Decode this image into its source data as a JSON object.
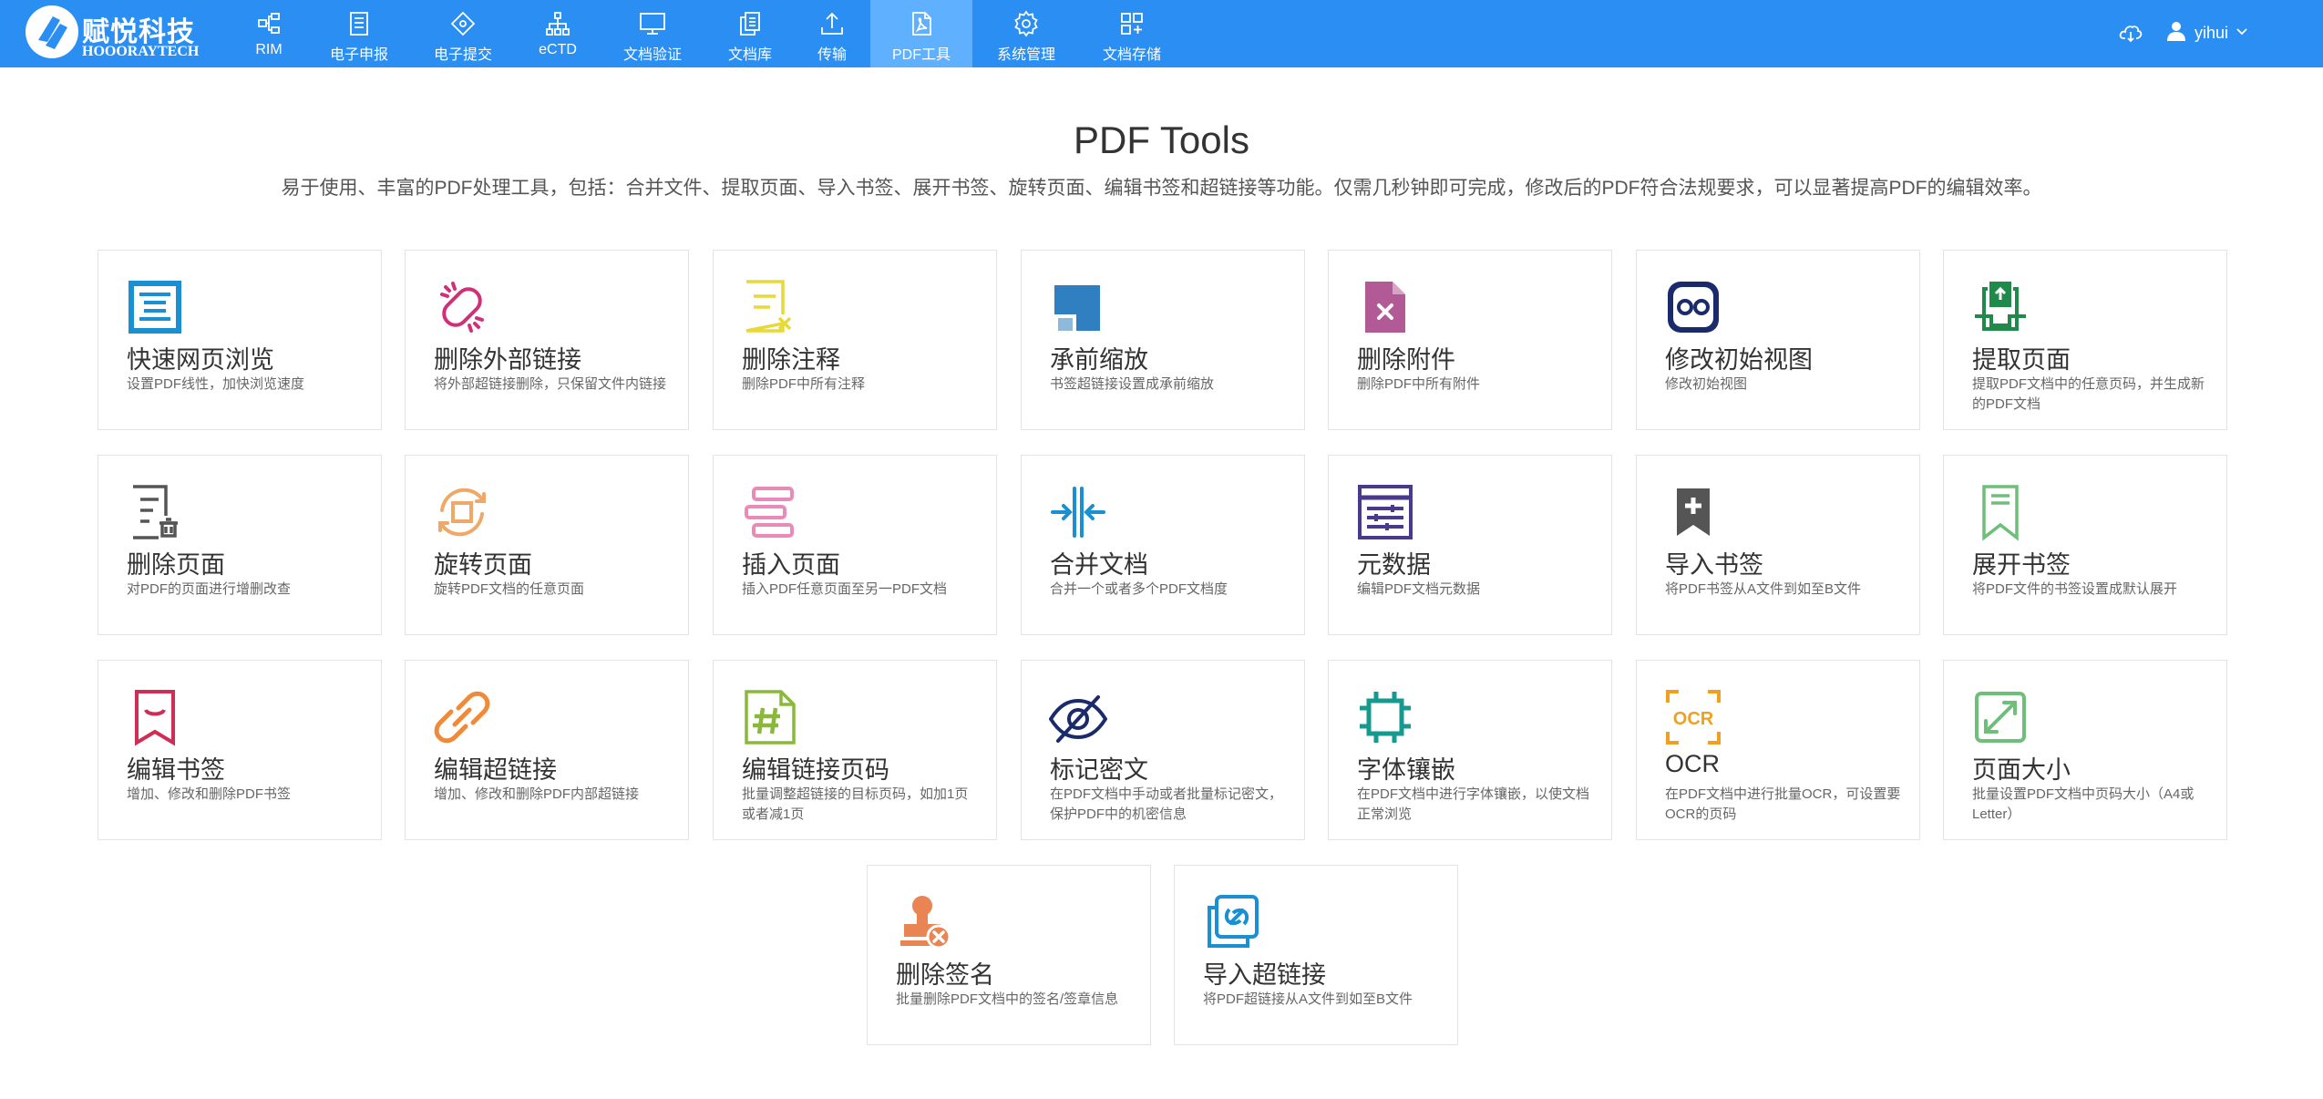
{
  "logo": {
    "cn": "赋悦科技",
    "en": "HOOORAYTECH"
  },
  "nav": [
    {
      "label": "RIM",
      "icon": "hierarchy-icon"
    },
    {
      "label": "电子申报",
      "icon": "document-list-icon"
    },
    {
      "label": "电子提交",
      "icon": "diamond-icon"
    },
    {
      "label": "eCTD",
      "icon": "sitemap-icon"
    },
    {
      "label": "文档验证",
      "icon": "monitor-icon"
    },
    {
      "label": "文档库",
      "icon": "documents-icon"
    },
    {
      "label": "传输",
      "icon": "upload-icon"
    },
    {
      "label": "PDF工具",
      "icon": "pdf-icon",
      "active": true
    },
    {
      "label": "系统管理",
      "icon": "gear-icon"
    },
    {
      "label": "文档存储",
      "icon": "grid-plus-icon"
    }
  ],
  "user": {
    "name": "yihui"
  },
  "header": {
    "title": "PDF Tools",
    "description": "易于使用、丰富的PDF处理工具，包括：合并文件、提取页面、导入书签、展开书签、旋转页面、编辑书签和超链接等功能。仅需几秒钟即可完成，修改后的PDF符合法规要求，可以显著提高PDF的编辑效率。"
  },
  "tools": [
    {
      "title": "快速网页浏览",
      "desc": "设置PDF线性，加快浏览速度",
      "icon": "fast-web-view-icon",
      "color": "#1a8fd1"
    },
    {
      "title": "删除外部链接",
      "desc": "将外部超链接删除，只保留文件内链接",
      "icon": "broken-link-icon",
      "color": "#d0307a"
    },
    {
      "title": "删除注释",
      "desc": "删除PDF中所有注释",
      "icon": "delete-note-icon",
      "color": "#e8d93a"
    },
    {
      "title": "承前缩放",
      "desc": "书签超链接设置成承前缩放",
      "icon": "inherit-zoom-icon",
      "color": "#2f7fc1"
    },
    {
      "title": "删除附件",
      "desc": "删除PDF中所有附件",
      "icon": "delete-attachment-icon",
      "color": "#b25a96"
    },
    {
      "title": "修改初始视图",
      "desc": "修改初始视图",
      "icon": "initial-view-icon",
      "color": "#1b2a6b"
    },
    {
      "title": "提取页面",
      "desc": "提取PDF文档中的任意页码，并生成新的PDF文档",
      "icon": "extract-page-icon",
      "color": "#1f8a4a"
    },
    {
      "title": "删除页面",
      "desc": "对PDF的页面进行增删改查",
      "icon": "delete-page-icon",
      "color": "#555555"
    },
    {
      "title": "旋转页面",
      "desc": "旋转PDF文档的任意页面",
      "icon": "rotate-page-icon",
      "color": "#f0a868"
    },
    {
      "title": "插入页面",
      "desc": "插入PDF任意页面至另一PDF文档",
      "icon": "insert-page-icon",
      "color": "#e88bb8"
    },
    {
      "title": "合并文档",
      "desc": "合并一个或者多个PDF文档度",
      "icon": "merge-icon",
      "color": "#1a8fd1"
    },
    {
      "title": "元数据",
      "desc": "编辑PDF文档元数据",
      "icon": "metadata-icon",
      "color": "#4b3a8c"
    },
    {
      "title": "导入书签",
      "desc": "将PDF书签从A文件到如至B文件",
      "icon": "import-bookmark-icon",
      "color": "#555555"
    },
    {
      "title": "展开书签",
      "desc": "将PDF文件的书签设置成默认展开",
      "icon": "expand-bookmark-icon",
      "color": "#6dbf7a"
    },
    {
      "title": "编辑书签",
      "desc": "增加、修改和删除PDF书签",
      "icon": "edit-bookmark-icon",
      "color": "#d02c55"
    },
    {
      "title": "编辑超链接",
      "desc": "增加、修改和删除PDF内部超链接",
      "icon": "edit-link-icon",
      "color": "#ee8a3a"
    },
    {
      "title": "编辑链接页码",
      "desc": "批量调整超链接的目标页码，如加1页或者减1页",
      "icon": "edit-link-page-icon",
      "color": "#8ab83a"
    },
    {
      "title": "标记密文",
      "desc": "在PDF文档中手动或者批量标记密文，保护PDF中的机密信息",
      "icon": "redact-icon",
      "color": "#1b2a6b"
    },
    {
      "title": "字体镶嵌",
      "desc": "在PDF文档中进行字体镶嵌，以使文档正常浏览",
      "icon": "font-embed-icon",
      "color": "#16998f"
    },
    {
      "title": "OCR",
      "desc": "在PDF文档中进行批量OCR，可设置要OCR的页码",
      "icon": "ocr-icon",
      "color": "#f0a020"
    },
    {
      "title": "页面大小",
      "desc": "批量设置PDF文档中页码大小（A4或Letter）",
      "icon": "page-size-icon",
      "color": "#6dbf7a"
    },
    {
      "title": "删除签名",
      "desc": "批量删除PDF文档中的签名/签章信息",
      "icon": "delete-signature-icon",
      "color": "#e98552"
    },
    {
      "title": "导入超链接",
      "desc": "将PDF超链接从A文件到如至B文件",
      "icon": "import-link-icon",
      "color": "#1a8fd1"
    }
  ]
}
